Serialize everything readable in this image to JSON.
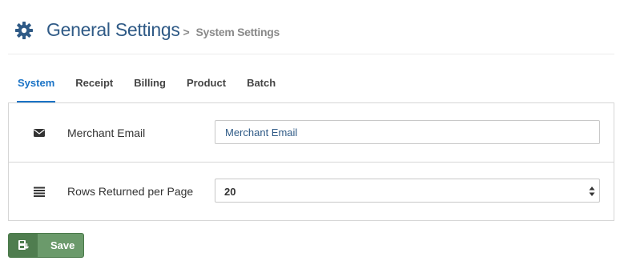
{
  "header": {
    "title": "General Settings",
    "separator": ">",
    "subtitle": "System Settings",
    "icon": "gear-icon"
  },
  "tabs": [
    {
      "label": "System",
      "active": true
    },
    {
      "label": "Receipt",
      "active": false
    },
    {
      "label": "Billing",
      "active": false
    },
    {
      "label": "Product",
      "active": false
    },
    {
      "label": "Batch",
      "active": false
    }
  ],
  "settings": {
    "merchant_email": {
      "icon": "envelope-icon",
      "label": "Merchant Email",
      "value": "",
      "placeholder": "Merchant Email"
    },
    "rows_per_page": {
      "icon": "list-icon",
      "label": "Rows Returned per Page",
      "selected": "20"
    }
  },
  "actions": {
    "save_label": "Save",
    "save_icon": "save-icon"
  },
  "colors": {
    "accent": "#1a73c6",
    "title": "#2f5a86",
    "save_button": "#6b9a6b",
    "save_button_icon_bg": "#4f7d4f"
  }
}
